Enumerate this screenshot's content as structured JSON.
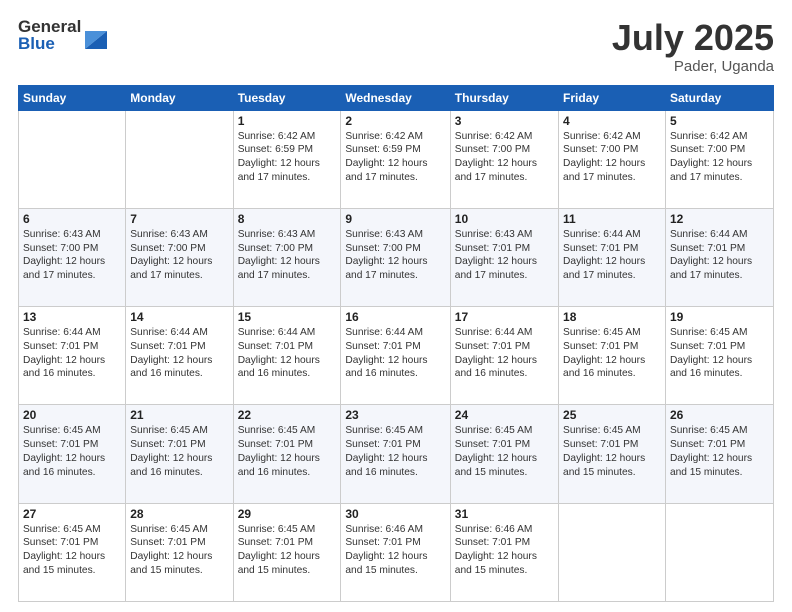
{
  "logo": {
    "general": "General",
    "blue": "Blue"
  },
  "header": {
    "month": "July 2025",
    "location": "Pader, Uganda"
  },
  "weekdays": [
    "Sunday",
    "Monday",
    "Tuesday",
    "Wednesday",
    "Thursday",
    "Friday",
    "Saturday"
  ],
  "weeks": [
    [
      {
        "day": "",
        "info": ""
      },
      {
        "day": "",
        "info": ""
      },
      {
        "day": "1",
        "info": "Sunrise: 6:42 AM\nSunset: 6:59 PM\nDaylight: 12 hours and 17 minutes."
      },
      {
        "day": "2",
        "info": "Sunrise: 6:42 AM\nSunset: 6:59 PM\nDaylight: 12 hours and 17 minutes."
      },
      {
        "day": "3",
        "info": "Sunrise: 6:42 AM\nSunset: 7:00 PM\nDaylight: 12 hours and 17 minutes."
      },
      {
        "day": "4",
        "info": "Sunrise: 6:42 AM\nSunset: 7:00 PM\nDaylight: 12 hours and 17 minutes."
      },
      {
        "day": "5",
        "info": "Sunrise: 6:42 AM\nSunset: 7:00 PM\nDaylight: 12 hours and 17 minutes."
      }
    ],
    [
      {
        "day": "6",
        "info": "Sunrise: 6:43 AM\nSunset: 7:00 PM\nDaylight: 12 hours and 17 minutes."
      },
      {
        "day": "7",
        "info": "Sunrise: 6:43 AM\nSunset: 7:00 PM\nDaylight: 12 hours and 17 minutes."
      },
      {
        "day": "8",
        "info": "Sunrise: 6:43 AM\nSunset: 7:00 PM\nDaylight: 12 hours and 17 minutes."
      },
      {
        "day": "9",
        "info": "Sunrise: 6:43 AM\nSunset: 7:00 PM\nDaylight: 12 hours and 17 minutes."
      },
      {
        "day": "10",
        "info": "Sunrise: 6:43 AM\nSunset: 7:01 PM\nDaylight: 12 hours and 17 minutes."
      },
      {
        "day": "11",
        "info": "Sunrise: 6:44 AM\nSunset: 7:01 PM\nDaylight: 12 hours and 17 minutes."
      },
      {
        "day": "12",
        "info": "Sunrise: 6:44 AM\nSunset: 7:01 PM\nDaylight: 12 hours and 17 minutes."
      }
    ],
    [
      {
        "day": "13",
        "info": "Sunrise: 6:44 AM\nSunset: 7:01 PM\nDaylight: 12 hours and 16 minutes."
      },
      {
        "day": "14",
        "info": "Sunrise: 6:44 AM\nSunset: 7:01 PM\nDaylight: 12 hours and 16 minutes."
      },
      {
        "day": "15",
        "info": "Sunrise: 6:44 AM\nSunset: 7:01 PM\nDaylight: 12 hours and 16 minutes."
      },
      {
        "day": "16",
        "info": "Sunrise: 6:44 AM\nSunset: 7:01 PM\nDaylight: 12 hours and 16 minutes."
      },
      {
        "day": "17",
        "info": "Sunrise: 6:44 AM\nSunset: 7:01 PM\nDaylight: 12 hours and 16 minutes."
      },
      {
        "day": "18",
        "info": "Sunrise: 6:45 AM\nSunset: 7:01 PM\nDaylight: 12 hours and 16 minutes."
      },
      {
        "day": "19",
        "info": "Sunrise: 6:45 AM\nSunset: 7:01 PM\nDaylight: 12 hours and 16 minutes."
      }
    ],
    [
      {
        "day": "20",
        "info": "Sunrise: 6:45 AM\nSunset: 7:01 PM\nDaylight: 12 hours and 16 minutes."
      },
      {
        "day": "21",
        "info": "Sunrise: 6:45 AM\nSunset: 7:01 PM\nDaylight: 12 hours and 16 minutes."
      },
      {
        "day": "22",
        "info": "Sunrise: 6:45 AM\nSunset: 7:01 PM\nDaylight: 12 hours and 16 minutes."
      },
      {
        "day": "23",
        "info": "Sunrise: 6:45 AM\nSunset: 7:01 PM\nDaylight: 12 hours and 16 minutes."
      },
      {
        "day": "24",
        "info": "Sunrise: 6:45 AM\nSunset: 7:01 PM\nDaylight: 12 hours and 15 minutes."
      },
      {
        "day": "25",
        "info": "Sunrise: 6:45 AM\nSunset: 7:01 PM\nDaylight: 12 hours and 15 minutes."
      },
      {
        "day": "26",
        "info": "Sunrise: 6:45 AM\nSunset: 7:01 PM\nDaylight: 12 hours and 15 minutes."
      }
    ],
    [
      {
        "day": "27",
        "info": "Sunrise: 6:45 AM\nSunset: 7:01 PM\nDaylight: 12 hours and 15 minutes."
      },
      {
        "day": "28",
        "info": "Sunrise: 6:45 AM\nSunset: 7:01 PM\nDaylight: 12 hours and 15 minutes."
      },
      {
        "day": "29",
        "info": "Sunrise: 6:45 AM\nSunset: 7:01 PM\nDaylight: 12 hours and 15 minutes."
      },
      {
        "day": "30",
        "info": "Sunrise: 6:46 AM\nSunset: 7:01 PM\nDaylight: 12 hours and 15 minutes."
      },
      {
        "day": "31",
        "info": "Sunrise: 6:46 AM\nSunset: 7:01 PM\nDaylight: 12 hours and 15 minutes."
      },
      {
        "day": "",
        "info": ""
      },
      {
        "day": "",
        "info": ""
      }
    ]
  ]
}
